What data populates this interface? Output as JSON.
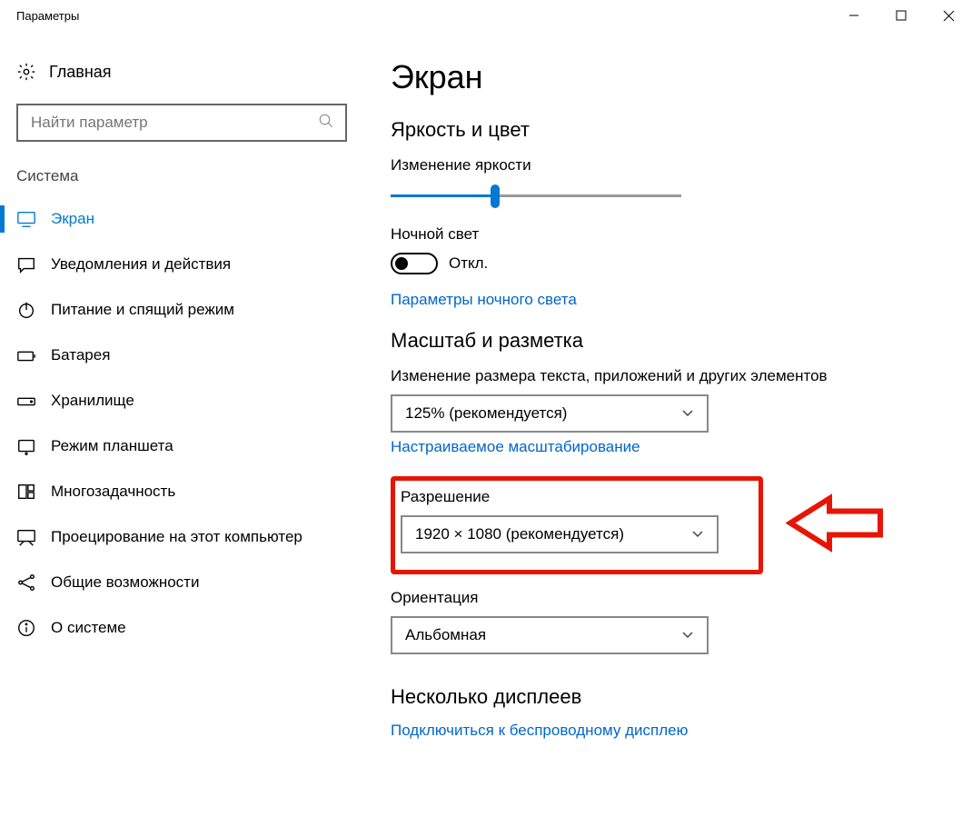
{
  "titlebar": {
    "title": "Параметры"
  },
  "sidebar": {
    "home": "Главная",
    "search_placeholder": "Найти параметр",
    "section": "Система",
    "items": [
      {
        "label": "Экран",
        "active": true,
        "icon": "display"
      },
      {
        "label": "Уведомления и действия",
        "active": false,
        "icon": "chat"
      },
      {
        "label": "Питание и спящий режим",
        "active": false,
        "icon": "power"
      },
      {
        "label": "Батарея",
        "active": false,
        "icon": "battery"
      },
      {
        "label": "Хранилище",
        "active": false,
        "icon": "storage"
      },
      {
        "label": "Режим планшета",
        "active": false,
        "icon": "tablet"
      },
      {
        "label": "Многозадачность",
        "active": false,
        "icon": "multitask"
      },
      {
        "label": "Проецирование на этот компьютер",
        "active": false,
        "icon": "project"
      },
      {
        "label": "Общие возможности",
        "active": false,
        "icon": "share"
      },
      {
        "label": "О системе",
        "active": false,
        "icon": "about"
      }
    ]
  },
  "main": {
    "title": "Экран",
    "brightness_section": "Яркость и цвет",
    "brightness_label": "Изменение яркости",
    "brightness_percent": 36,
    "night_light_label": "Ночной свет",
    "night_light_state": "Откл.",
    "night_light_link": "Параметры ночного света",
    "scale_section": "Масштаб и разметка",
    "scale_label": "Изменение размера текста, приложений и других элементов",
    "scale_value": "125% (рекомендуется)",
    "scale_link": "Настраиваемое масштабирование",
    "resolution_label": "Разрешение",
    "resolution_value": "1920 × 1080 (рекомендуется)",
    "orientation_label": "Ориентация",
    "orientation_value": "Альбомная",
    "multi_section": "Несколько дисплеев",
    "wireless_link": "Подключиться к беспроводному дисплею"
  }
}
